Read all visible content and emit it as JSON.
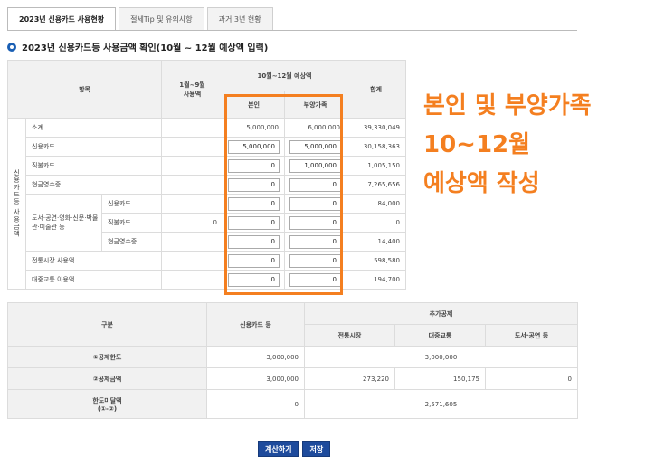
{
  "tabs": [
    {
      "label": "2023년 신용카드 사용현황",
      "active": true
    },
    {
      "label": "절세Tip 및 유의사항",
      "active": false
    },
    {
      "label": "과거 3년 현황",
      "active": false
    }
  ],
  "section": {
    "title": "2023년 신용카드등 사용금액 확인(10월 ~ 12월 예상액 입력)"
  },
  "top_table": {
    "col_item": "항목",
    "col_jan_sep_1": "1월~9월",
    "col_jan_sep_2": "사용액",
    "col_oct_dec": "10월~12월 예상액",
    "col_self": "본인",
    "col_dependent": "부양가족",
    "col_total": "합계",
    "vertical_label": "신용카드등 사용금액",
    "rows": [
      {
        "label": "소계",
        "jan_sep": "",
        "self": "5,000,000",
        "dep": "6,000,000",
        "total": "39,330,049"
      },
      {
        "label": "신용카드",
        "jan_sep": "",
        "self": "5,000,000",
        "dep": "5,000,000",
        "total": "30,158,363"
      },
      {
        "label": "직불카드",
        "jan_sep": "",
        "self": "0",
        "dep": "1,000,000",
        "total": "1,005,150"
      },
      {
        "label": "현금영수증",
        "jan_sep": "",
        "self": "0",
        "dep": "0",
        "total": "7,265,656"
      },
      {
        "label": "신용카드",
        "jan_sep": "",
        "self": "0",
        "dep": "0",
        "total": "84,000"
      },
      {
        "label": "직불카드",
        "jan_sep": "0",
        "self": "0",
        "dep": "0",
        "total": "0"
      },
      {
        "label": "현금영수증",
        "jan_sep": "",
        "self": "0",
        "dep": "0",
        "total": "14,400"
      },
      {
        "label": "전통시장 사용액",
        "jan_sep": "",
        "self": "0",
        "dep": "0",
        "total": "598,580"
      },
      {
        "label": "대중교통 이용액",
        "jan_sep": "",
        "self": "0",
        "dep": "0",
        "total": "194,700"
      }
    ],
    "culture_group": "도서·공연·영화·신문·박물관·미술관 등"
  },
  "annotation": {
    "line1": "본인 및 부양가족",
    "line2": "10~12월",
    "line3": "예상액 작성"
  },
  "bottom_table": {
    "col_category": "구분",
    "col_credit": "신용카드 등",
    "col_extra": "추가공제",
    "col_market": "전통시장",
    "col_transit": "대중교통",
    "col_culture": "도서·공연 등",
    "row1_label": "①공제한도",
    "row1_credit": "3,000,000",
    "row1_extra": "3,000,000",
    "row2_label": "②공제금액",
    "row2_credit": "3,000,000",
    "row2_market": "273,220",
    "row2_transit": "150,175",
    "row2_culture": "0",
    "row3_label_1": "한도미달액",
    "row3_label_2": "(①-②)",
    "row3_credit": "0",
    "row3_extra": "2,571,605"
  },
  "buttons": {
    "calculate": "계산하기",
    "save": "저장"
  },
  "colors": {
    "accent": "#f47f20",
    "button": "#1e4b9c",
    "bullet": "#1a5fb4"
  }
}
